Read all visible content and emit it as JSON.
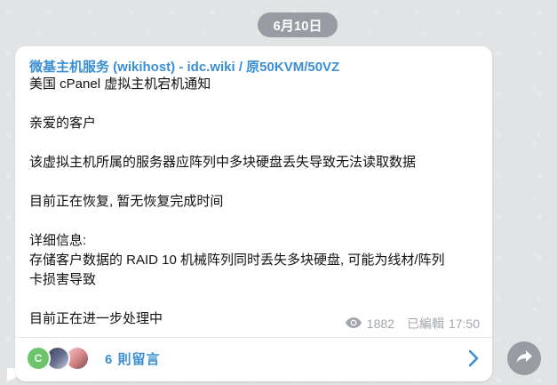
{
  "date_label": "6月10日",
  "message": {
    "sender": "微基主机服务 (wikihost) - idc.wiki / 原50KVM/50VZ",
    "lines": [
      "美国 cPanel 虚拟主机宕机通知",
      "亲爱的客户",
      "该虚拟主机所属的服务器应阵列中多块硬盘丢失导致无法读取数据",
      "目前正在恢复, 暂无恢复完成时间",
      "详细信息:",
      "存储客户数据的 RAID 10 机械阵列同时丢失多块硬盘, 可能为线材/阵列",
      "卡损害导致",
      "目前正在进一步处理中"
    ],
    "views": "1882",
    "edited_label": "已編輯",
    "time": "17:50"
  },
  "comments": {
    "avatar_initial": "C",
    "label": "6 則留言"
  },
  "colors": {
    "accent": "#3a8fd4",
    "meta": "#a3a7ad",
    "avatar_c": "#6cc56a"
  },
  "icons": {
    "views": "eye-icon",
    "chevron": "chevron-right-icon",
    "share": "share-forward-icon"
  }
}
